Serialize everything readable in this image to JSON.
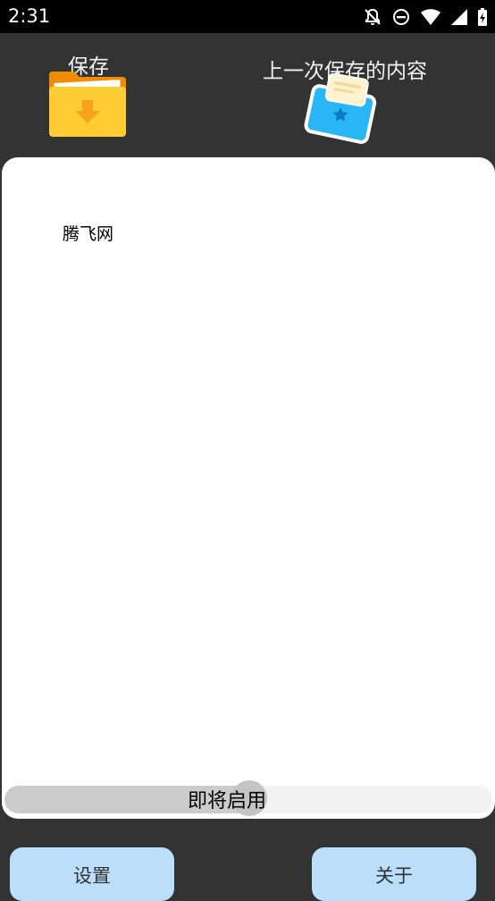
{
  "status_bar": {
    "time": "2:31",
    "icons": [
      "notifications-off-icon",
      "do-not-disturb-icon",
      "wifi-icon",
      "signal-icon",
      "battery-charging-icon"
    ]
  },
  "header": {
    "save_label": "保存",
    "last_saved_label": "上一次保存的内容",
    "save_icon": "folder-download-icon",
    "last_saved_icon": "clipboard-paste-icon"
  },
  "editor": {
    "content": "腾飞网"
  },
  "toggle": {
    "label": "即将启用",
    "level": 0.5
  },
  "bottom_bar": {
    "settings_label": "设置",
    "about_label": "关于"
  },
  "colors": {
    "background": "#333333",
    "card": "#ffffff",
    "button": "#bbdefb",
    "folder_orange": "#f08c00",
    "folder_yellow": "#ffcc33",
    "clip_blue": "#29b6f6"
  }
}
